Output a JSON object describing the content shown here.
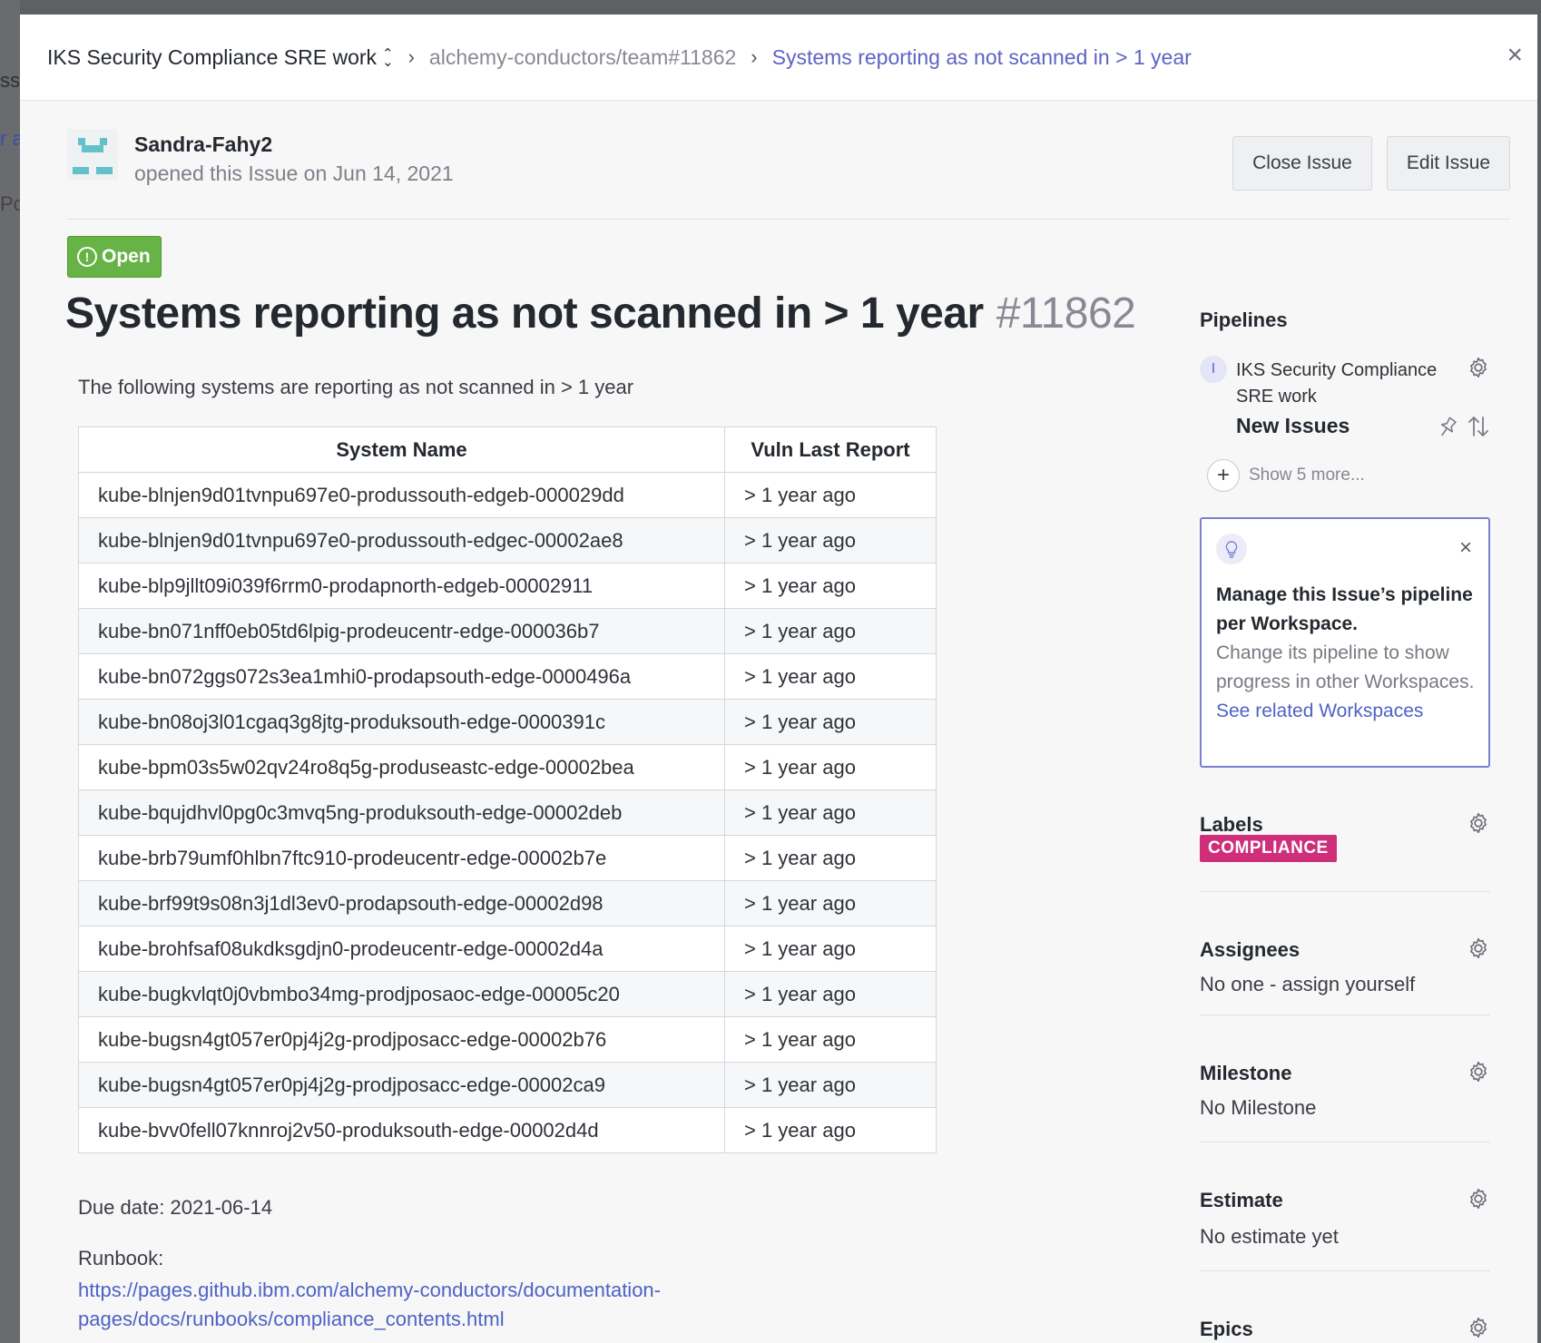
{
  "breadcrumb": {
    "workspace": "IKS Security Compliance SRE work",
    "repo": "alchemy-conductors/team#11862",
    "current": "Systems reporting as not scanned in > 1 year"
  },
  "background_fragments": [
    "ssi",
    "r a",
    "Po"
  ],
  "author": {
    "name": "Sandra-Fahy2",
    "meta": "opened this Issue on Jun 14, 2021"
  },
  "actions": {
    "close": "Close Issue",
    "edit": "Edit Issue"
  },
  "status": "Open",
  "issue": {
    "title": "Systems reporting as not scanned in > 1 year",
    "number": "#11862",
    "description": "The following systems are reporting as not scanned in > 1 year",
    "due_date": "Due date: 2021-06-14",
    "runbook_label": "Runbook:",
    "runbook_url": "https://pages.github.ibm.com/alchemy-conductors/documentation-pages/docs/runbooks/compliance_contents.html"
  },
  "table": {
    "headers": [
      "System Name",
      "Vuln Last Report"
    ],
    "rows": [
      [
        "kube-blnjen9d01tvnpu697e0-produssouth-edgeb-000029dd",
        "> 1 year ago"
      ],
      [
        "kube-blnjen9d01tvnpu697e0-produssouth-edgec-00002ae8",
        "> 1 year ago"
      ],
      [
        "kube-blp9jllt09i039f6rrm0-prodapnorth-edgeb-00002911",
        "> 1 year ago"
      ],
      [
        "kube-bn071nff0eb05td6lpig-prodeucentr-edge-000036b7",
        "> 1 year ago"
      ],
      [
        "kube-bn072ggs072s3ea1mhi0-prodapsouth-edge-0000496a",
        "> 1 year ago"
      ],
      [
        "kube-bn08oj3l01cgaq3g8jtg-produksouth-edge-0000391c",
        "> 1 year ago"
      ],
      [
        "kube-bpm03s5w02qv24ro8q5g-produseastc-edge-00002bea",
        "> 1 year ago"
      ],
      [
        "kube-bqujdhvl0pg0c3mvq5ng-produksouth-edge-00002deb",
        "> 1 year ago"
      ],
      [
        "kube-brb79umf0hlbn7ftc910-prodeucentr-edge-00002b7e",
        "> 1 year ago"
      ],
      [
        "kube-brf99t9s08n3j1dl3ev0-prodapsouth-edge-00002d98",
        "> 1 year ago"
      ],
      [
        "kube-brohfsaf08ukdksgdjn0-prodeucentr-edge-00002d4a",
        "> 1 year ago"
      ],
      [
        "kube-bugkvlqt0j0vbmbo34mg-prodjposaoc-edge-00005c20",
        "> 1 year ago"
      ],
      [
        "kube-bugsn4gt057er0pj4j2g-prodjposacc-edge-00002b76",
        "> 1 year ago"
      ],
      [
        "kube-bugsn4gt057er0pj4j2g-prodjposacc-edge-00002ca9",
        "> 1 year ago"
      ],
      [
        "kube-bvv0fell07knnroj2v50-produksouth-edge-00002d4d",
        "> 1 year ago"
      ]
    ]
  },
  "sidebar": {
    "pipelines": {
      "heading": "Pipelines",
      "badge": "I",
      "workspace": "IKS Security Compliance SRE work",
      "stage": "New Issues",
      "show_more": "Show 5 more..."
    },
    "tip": {
      "title": "Manage this Issue’s pipeline per Workspace.",
      "body": "Change its pipeline to show progress in other Workspaces.",
      "link": "See related Workspaces"
    },
    "labels": {
      "heading": "Labels",
      "items": [
        "COMPLIANCE"
      ]
    },
    "assignees": {
      "heading": "Assignees",
      "value": "No one - assign yourself"
    },
    "milestone": {
      "heading": "Milestone",
      "value": "No Milestone"
    },
    "estimate": {
      "heading": "Estimate",
      "value": "No estimate yet"
    },
    "epics": {
      "heading": "Epics"
    }
  },
  "colors": {
    "accent": "#5e63c4",
    "open_badge": "#67b346",
    "label_compliance": "#cf2f7a",
    "link": "#4d62c4"
  }
}
